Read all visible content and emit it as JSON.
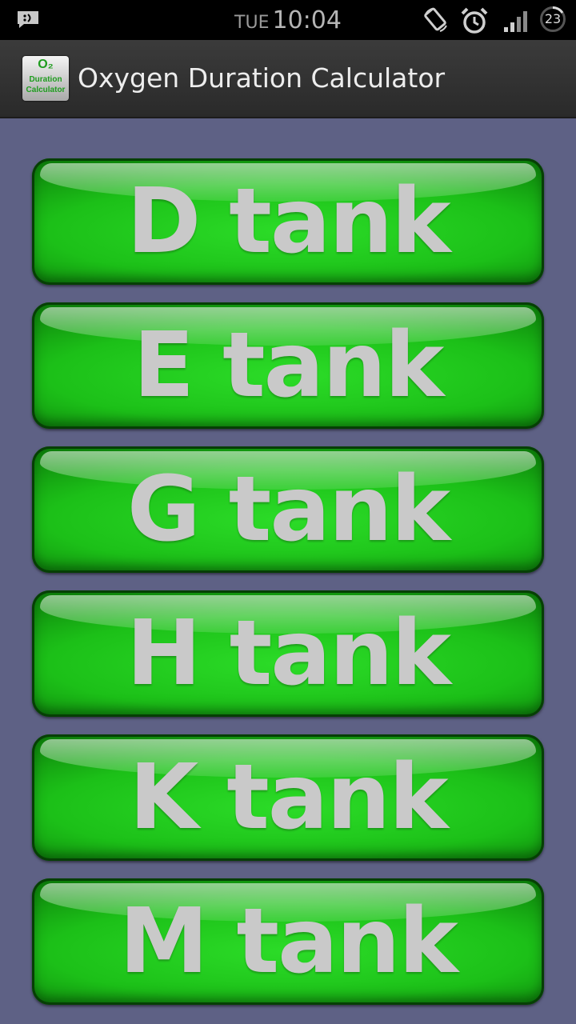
{
  "status_bar": {
    "day": "TUE",
    "time": "10:04",
    "battery_level": "23",
    "icons": [
      "notification-icon",
      "screen-rotation-icon",
      "alarm-icon",
      "signal-icon",
      "battery-icon"
    ]
  },
  "action_bar": {
    "title": "Oxygen Duration Calculator",
    "app_icon_text": {
      "line1": "O₂",
      "line2": "Duration",
      "line3": "Calculator"
    }
  },
  "tanks": [
    {
      "label": "D tank"
    },
    {
      "label": "E tank"
    },
    {
      "label": "G tank"
    },
    {
      "label": "H tank"
    },
    {
      "label": "K tank"
    },
    {
      "label": "M tank"
    }
  ],
  "colors": {
    "background": "#5e6185",
    "button_green": "#1cc018",
    "button_text": "#c9c9c9"
  }
}
